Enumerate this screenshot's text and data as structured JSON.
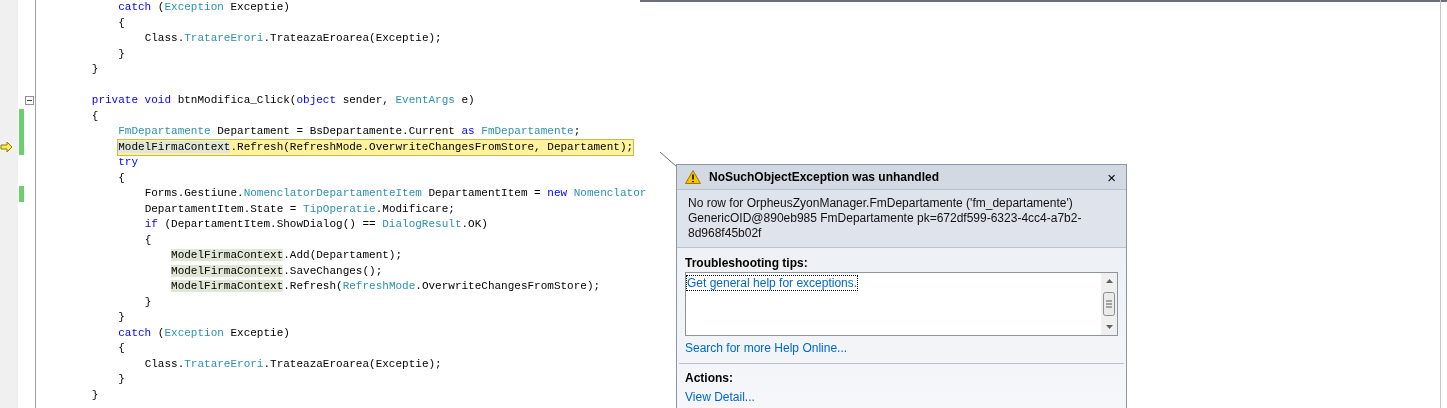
{
  "code_lines": [
    {
      "kind": "code",
      "tokens": [
        {
          "t": "            catch",
          "kind": "kw"
        },
        {
          "t": " (",
          "kind": "plain"
        },
        {
          "t": "Exception",
          "kind": "type"
        },
        {
          "t": " Exceptie)",
          "kind": "plain"
        }
      ]
    },
    {
      "kind": "code",
      "tokens": [
        {
          "t": "            {",
          "kind": "plain"
        }
      ]
    },
    {
      "kind": "code",
      "tokens": [
        {
          "t": "                Class.",
          "kind": "plain"
        },
        {
          "t": "TratareErori",
          "kind": "type"
        },
        {
          "t": ".TrateazaEroarea(Exceptie);",
          "kind": "plain"
        }
      ]
    },
    {
      "kind": "code",
      "tokens": [
        {
          "t": "            }",
          "kind": "plain"
        }
      ]
    },
    {
      "kind": "code",
      "tokens": [
        {
          "t": "        }",
          "kind": "plain"
        }
      ]
    },
    {
      "kind": "blank"
    },
    {
      "kind": "code",
      "collapsible": true,
      "tokens": [
        {
          "t": "        private void",
          "kind": "kw"
        },
        {
          "t": " btnModifica_Click(",
          "kind": "plain"
        },
        {
          "t": "object",
          "kind": "kw"
        },
        {
          "t": " sender, ",
          "kind": "plain"
        },
        {
          "t": "EventArgs",
          "kind": "type"
        },
        {
          "t": " e)",
          "kind": "plain"
        }
      ]
    },
    {
      "kind": "code",
      "changed": true,
      "tokens": [
        {
          "t": "        {",
          "kind": "plain"
        }
      ]
    },
    {
      "kind": "code",
      "changed": true,
      "tokens": [
        {
          "t": "            FmDepartamente",
          "kind": "type"
        },
        {
          "t": " Departament = BsDepartamente.Current ",
          "kind": "plain"
        },
        {
          "t": "as",
          "kind": "kw"
        },
        {
          "t": " FmDepartamente",
          "kind": "type"
        },
        {
          "t": ";",
          "kind": "plain"
        }
      ]
    },
    {
      "kind": "code",
      "changed": true,
      "current": true,
      "tokens": [
        {
          "t": "            ModelFirmaContext",
          "kind": "ref"
        },
        {
          "t": ".Refresh(RefreshMode.OverwriteChangesFromStore, Departament);",
          "kind": "plain"
        }
      ]
    },
    {
      "kind": "code",
      "tokens": [
        {
          "t": "            try",
          "kind": "kw"
        }
      ]
    },
    {
      "kind": "code",
      "tokens": [
        {
          "t": "            {",
          "kind": "plain"
        }
      ]
    },
    {
      "kind": "code",
      "changed": true,
      "tokens": [
        {
          "t": "                Forms.Gestiune.",
          "kind": "plain"
        },
        {
          "t": "NomenclatorDepartamenteItem",
          "kind": "type"
        },
        {
          "t": " DepartamentItem = ",
          "kind": "plain"
        },
        {
          "t": "new",
          "kind": "kw"
        },
        {
          "t": " Nomenclator",
          "kind": "type"
        }
      ]
    },
    {
      "kind": "code",
      "tokens": [
        {
          "t": "                DepartamentItem.State = ",
          "kind": "plain"
        },
        {
          "t": "TipOperatie",
          "kind": "type"
        },
        {
          "t": ".Modificare;",
          "kind": "plain"
        }
      ]
    },
    {
      "kind": "code",
      "tokens": [
        {
          "t": "                if",
          "kind": "kw"
        },
        {
          "t": " (DepartamentItem.ShowDialog() == ",
          "kind": "plain"
        },
        {
          "t": "DialogResult",
          "kind": "type"
        },
        {
          "t": ".OK)",
          "kind": "plain"
        }
      ]
    },
    {
      "kind": "code",
      "tokens": [
        {
          "t": "                {",
          "kind": "plain"
        }
      ]
    },
    {
      "kind": "code",
      "tokens": [
        {
          "t": "                    ModelFirmaContext",
          "kind": "ref"
        },
        {
          "t": ".Add(Departament);",
          "kind": "plain"
        }
      ]
    },
    {
      "kind": "code",
      "tokens": [
        {
          "t": "                    ModelFirmaContext",
          "kind": "ref"
        },
        {
          "t": ".SaveChanges();",
          "kind": "plain"
        }
      ]
    },
    {
      "kind": "code",
      "tokens": [
        {
          "t": "                    ModelFirmaContext",
          "kind": "ref"
        },
        {
          "t": ".Refresh(",
          "kind": "plain"
        },
        {
          "t": "RefreshMode",
          "kind": "type"
        },
        {
          "t": ".OverwriteChangesFromStore);",
          "kind": "plain"
        }
      ]
    },
    {
      "kind": "code",
      "tokens": [
        {
          "t": "                }",
          "kind": "plain"
        }
      ]
    },
    {
      "kind": "code",
      "tokens": [
        {
          "t": "            }",
          "kind": "plain"
        }
      ]
    },
    {
      "kind": "code",
      "tokens": [
        {
          "t": "            catch",
          "kind": "kw"
        },
        {
          "t": " (",
          "kind": "plain"
        },
        {
          "t": "Exception",
          "kind": "type"
        },
        {
          "t": " Exceptie)",
          "kind": "plain"
        }
      ]
    },
    {
      "kind": "code",
      "tokens": [
        {
          "t": "            {",
          "kind": "plain"
        }
      ]
    },
    {
      "kind": "code",
      "tokens": [
        {
          "t": "                Class.",
          "kind": "plain"
        },
        {
          "t": "TratareErori",
          "kind": "type"
        },
        {
          "t": ".TrateazaEroarea(Exceptie);",
          "kind": "plain"
        }
      ]
    },
    {
      "kind": "code",
      "tokens": [
        {
          "t": "            }",
          "kind": "plain"
        }
      ]
    },
    {
      "kind": "code",
      "tokens": [
        {
          "t": "        }",
          "kind": "plain"
        }
      ]
    }
  ],
  "exception_helper": {
    "title": "NoSuchObjectException was unhandled",
    "close": "×",
    "message": "No row for OrpheusZyonManager.FmDepartamente ('fm_departamente') GenericOID@890eb985 FmDepartamente pk=672df599-6323-4cc4-a7b2-8d968f45b02f",
    "tips_heading": "Troubleshooting tips:",
    "tips": [
      {
        "label": "Get general help for exceptions.",
        "selected": true
      }
    ],
    "help_link": "Search for more Help Online...",
    "actions_heading": "Actions:",
    "actions": [
      "View Detail..."
    ]
  }
}
